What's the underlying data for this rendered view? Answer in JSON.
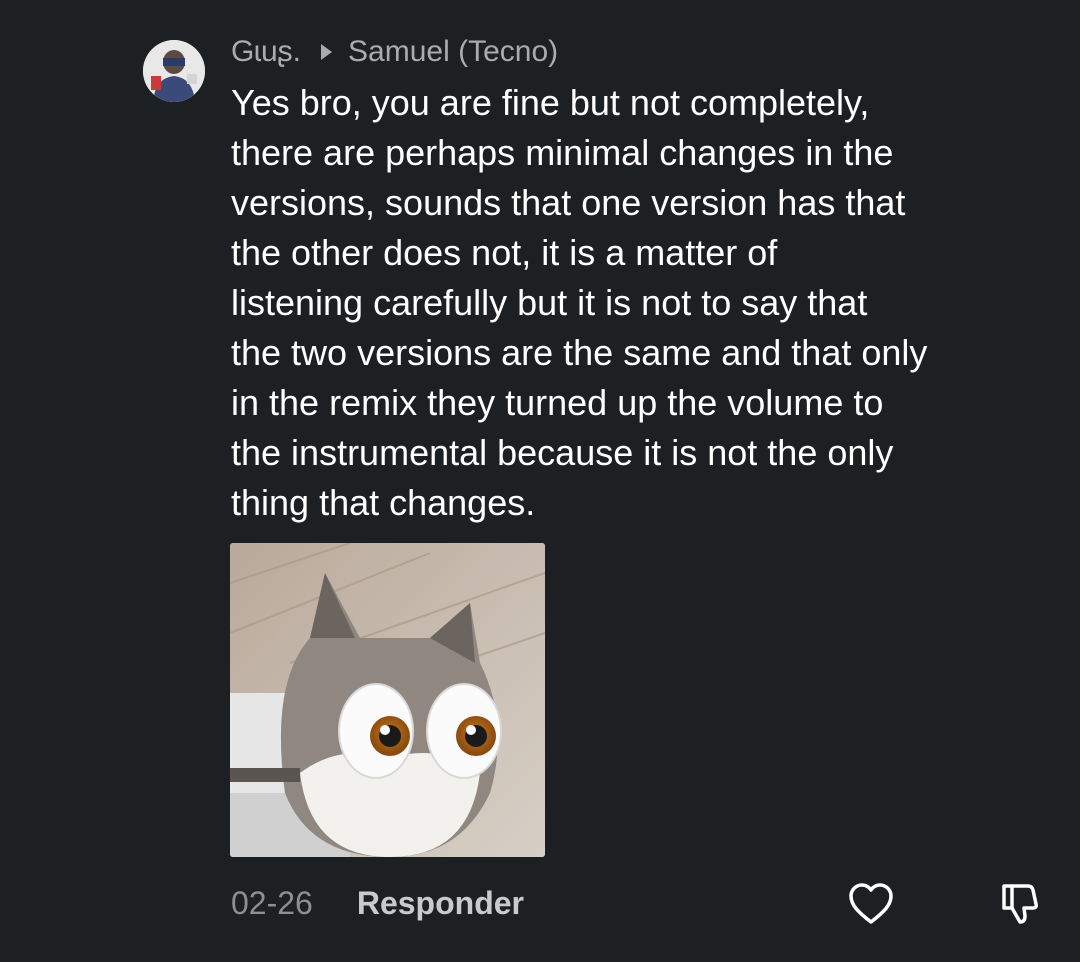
{
  "comment": {
    "author": "Gɩuʂ.",
    "reply_to": "Samuel (Tecno)",
    "text_lines": [
      "Yes bro, you are fine but not completely,",
      "there are perhaps minimal changes in the",
      "versions, sounds that one version has that",
      "the other does not, it is a matter of",
      "listening carefully but it is not to say that",
      "the two versions are the same and that only",
      "in the remix they turned up the volume to",
      "the instrumental because it is not the only",
      "thing that changes."
    ],
    "sticker_icon": "cat-with-big-eyes-sticker",
    "date": "02-26",
    "reply_label": "Responder",
    "like_icon": "heart-icon",
    "dislike_icon": "thumbs-down-icon"
  },
  "colors": {
    "background": "#1d2022",
    "text": "#ffffff",
    "muted": "#a9acae"
  }
}
